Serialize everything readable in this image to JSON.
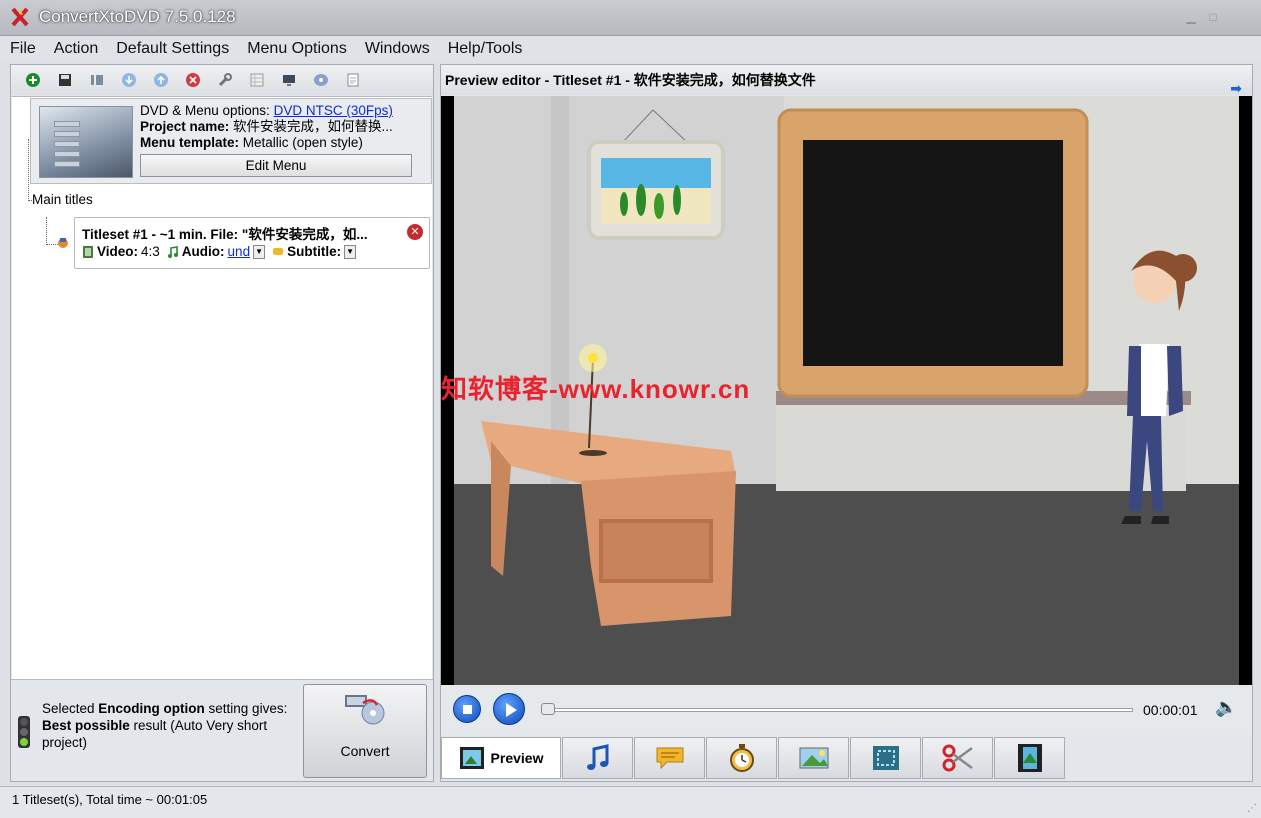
{
  "window": {
    "title": "ConvertXtoDVD 7.5.0.128"
  },
  "menu": [
    "File",
    "Action",
    "Default Settings",
    "Menu Options",
    "Windows",
    "Help/Tools"
  ],
  "toolbar_icons": [
    "add-icon",
    "save-icon",
    "chapters-icon",
    "move-down-icon",
    "move-up-icon",
    "remove-icon",
    "wrench-icon",
    "grid-icon",
    "monitor-icon",
    "disc-icon",
    "document-icon"
  ],
  "project": {
    "dvd_options_label": "DVD & Menu options:",
    "dvd_options_value": "DVD NTSC (30Fps)",
    "project_name_label": "Project name:",
    "project_name_value": "软件安装完成，如何替换...",
    "menu_template_label": "Menu template:",
    "menu_template_value": "Metallic (open style)",
    "edit_menu": "Edit Menu"
  },
  "tree": {
    "main_titles": "Main titles"
  },
  "titleset": {
    "title": "Titleset #1 - ~1 min. File: \"软件安装完成，如...",
    "video_label": "Video:",
    "video_value": "4:3",
    "audio_label": "Audio:",
    "audio_value": "und",
    "subtitle_label": "Subtitle:"
  },
  "encoding": {
    "line1": "Selected ",
    "line1_bold": "Encoding option",
    "line1_end": " setting gives:",
    "line2_bold": "Best possible",
    "line2_end": " result (Auto Very short project)"
  },
  "convert_button": "Convert",
  "preview": {
    "header": "Preview editor - Titleset #1 - 软件安装完成，如何替换文件"
  },
  "player": {
    "time": "00:00:01",
    "progress": 0
  },
  "tabs": [
    {
      "label": "Preview",
      "icon": "film-icon"
    },
    {
      "icon": "music-icon"
    },
    {
      "icon": "subtitle-icon"
    },
    {
      "icon": "stopwatch-icon"
    },
    {
      "icon": "picture-icon"
    },
    {
      "icon": "crop-icon"
    },
    {
      "icon": "scissors-icon"
    },
    {
      "icon": "film-strip-icon"
    }
  ],
  "watermark": "知软博客-www.knowr.cn",
  "status": "1 Titleset(s), Total time ~ 00:01:05"
}
